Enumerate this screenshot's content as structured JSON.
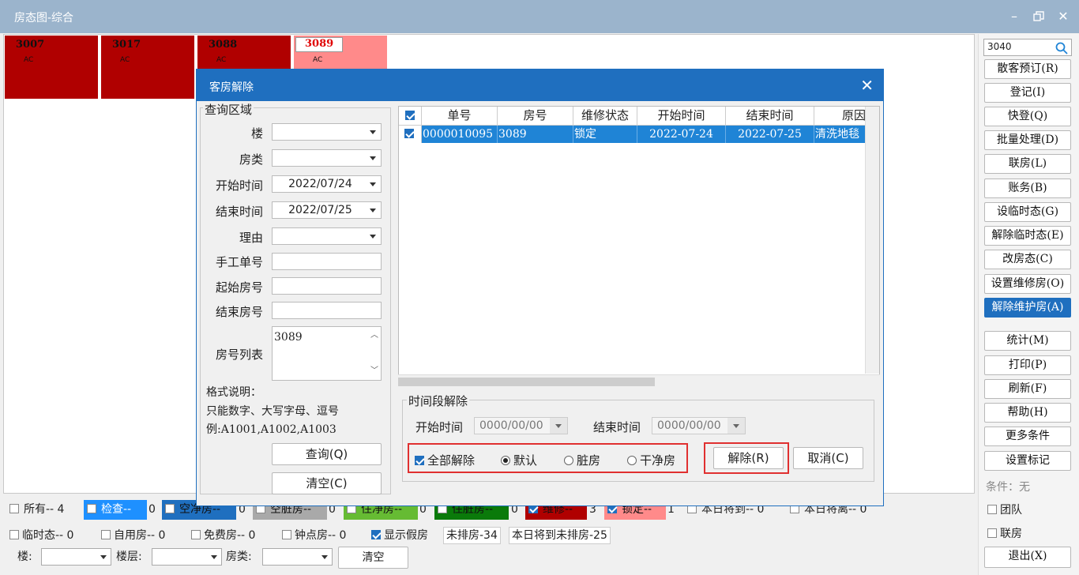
{
  "window": {
    "title": "房态图-综合",
    "controls": [
      "minimize",
      "restore",
      "close"
    ]
  },
  "rooms": [
    {
      "number": "3007",
      "tag": "AC",
      "status": "maintenance"
    },
    {
      "number": "3017",
      "tag": "AC",
      "status": "maintenance"
    },
    {
      "number": "3088",
      "tag": "AC",
      "status": "maintenance"
    },
    {
      "number": "3089",
      "tag": "AC",
      "status": "locked"
    }
  ],
  "right_panel": {
    "search_value": "3040",
    "buttons": [
      "散客预订(R)",
      "登记(I)",
      "快登(Q)",
      "批量处理(D)",
      "联房(L)",
      "账务(B)",
      "设临时态(G)",
      "解除临时态(E)",
      "改房态(C)",
      "设置维修房(O)",
      "解除维护房(A)"
    ],
    "active_button": "解除维护房(A)",
    "buttons2": [
      "统计(M)",
      "打印(P)",
      "刷新(F)",
      "帮助(H)",
      "更多条件",
      "设置标记"
    ],
    "condition_label": "条件：无",
    "check_team": "团队",
    "check_link": "联房",
    "exit_button": "退出(X)"
  },
  "legend": {
    "row1": [
      {
        "label": "所有-- 4"
      },
      {
        "label": "检查--",
        "count": "0",
        "color": "#1e90ff"
      },
      {
        "label": "空净房--",
        "count": "0",
        "color": "#1f6fbf"
      },
      {
        "label": "空脏房--",
        "count": "0",
        "color": "#a9a9a9"
      },
      {
        "label": "住净房--",
        "count": "0",
        "color": "#66bb33"
      },
      {
        "label": "住脏房--",
        "count": "0",
        "color": "#0a7a0a"
      },
      {
        "label": "维修--",
        "count": "3",
        "color": "#b00000"
      },
      {
        "label": "锁定--",
        "count": "1",
        "color": "#ff8a8a"
      },
      {
        "label": "本日将到-- 0"
      },
      {
        "label": "本日将离-- 0"
      }
    ],
    "row2": [
      "临时态-- 0",
      "自用房-- 0",
      "免费房-- 0",
      "钟点房-- 0",
      "显示假房"
    ],
    "tag_unassigned": "未排房-34",
    "tag_arriving_unassigned": "本日将到未排房-25",
    "floor_label": "楼:",
    "level_label": "楼层:",
    "type_label": "房类:",
    "clear_button": "清空"
  },
  "dialog": {
    "title": "客房解除",
    "query": {
      "group_title": "查询区域",
      "floor_label": "楼",
      "type_label": "房类",
      "start_label": "开始时间",
      "start_value": "2022/07/24",
      "end_label": "结束时间",
      "end_value": "2022/07/25",
      "reason_label": "理由",
      "manual_label": "手工单号",
      "from_room_label": "起始房号",
      "to_room_label": "结束房号",
      "rooms_label": "房号列表",
      "rooms_value": "3089",
      "format_note1": "格式说明：",
      "format_note2": "只能数字、大写字母、逗号",
      "format_note3": "例:A1001,A1002,A1003",
      "query_button": "查询(Q)",
      "clear_button": "清空(C)"
    },
    "grid": {
      "headers": [
        "单号",
        "房号",
        "维修状态",
        "开始时间",
        "结束时间",
        "原因"
      ],
      "rows": [
        {
          "order": "0000010095",
          "room": "3089",
          "status": "锁定",
          "start": "2022-07-24",
          "end": "2022-07-25",
          "reason": "清洗地毯"
        }
      ]
    },
    "period": {
      "group_title": "时间段解除",
      "start_label": "开始时间",
      "start_value": "0000/00/00",
      "end_label": "结束时间",
      "end_value": "0000/00/00",
      "all_release": "全部解除",
      "opt_default": "默认",
      "opt_dirty": "脏房",
      "opt_clean": "干净房",
      "release_button": "解除(R)",
      "cancel_button": "取消(C)"
    }
  }
}
